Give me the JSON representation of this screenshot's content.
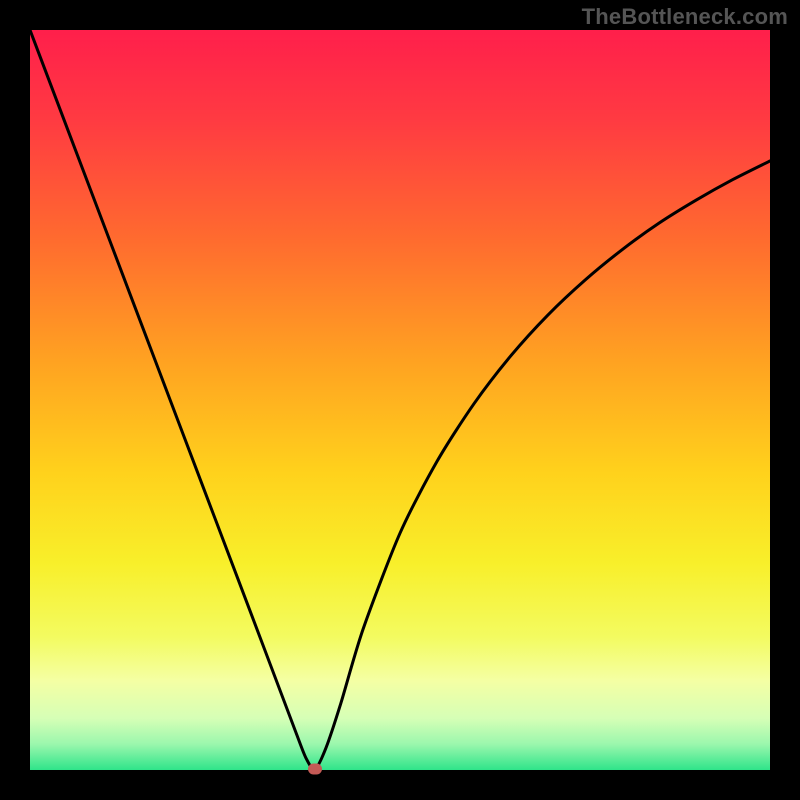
{
  "watermark": "TheBottleneck.com",
  "chart_data": {
    "type": "line",
    "title": "",
    "xlabel": "",
    "ylabel": "",
    "xlim": [
      0,
      100
    ],
    "ylim": [
      0,
      100
    ],
    "x": [
      0,
      5,
      10,
      15,
      20,
      25,
      30,
      34,
      36,
      37.3,
      38.5,
      40,
      42,
      45,
      50,
      55,
      60,
      65,
      70,
      75,
      80,
      85,
      90,
      95,
      100
    ],
    "values": [
      100,
      86.8,
      73.6,
      60.4,
      47.2,
      34,
      20.8,
      10.2,
      4.9,
      1.6,
      0.1,
      3,
      9,
      19,
      32,
      41.7,
      49.5,
      56,
      61.5,
      66.2,
      70.3,
      73.9,
      77,
      79.8,
      82.3
    ],
    "marker": {
      "x": 38.5,
      "y": 0.1
    },
    "gradient_stops": [
      {
        "offset": 0,
        "color": "#ff1f4b"
      },
      {
        "offset": 0.12,
        "color": "#ff3a42"
      },
      {
        "offset": 0.28,
        "color": "#ff6a2f"
      },
      {
        "offset": 0.45,
        "color": "#ffa321"
      },
      {
        "offset": 0.6,
        "color": "#ffd21c"
      },
      {
        "offset": 0.72,
        "color": "#f8ef2a"
      },
      {
        "offset": 0.82,
        "color": "#f3fb60"
      },
      {
        "offset": 0.88,
        "color": "#f4ffa4"
      },
      {
        "offset": 0.93,
        "color": "#d6ffb6"
      },
      {
        "offset": 0.965,
        "color": "#9bf7ad"
      },
      {
        "offset": 1.0,
        "color": "#2fe48a"
      }
    ]
  }
}
